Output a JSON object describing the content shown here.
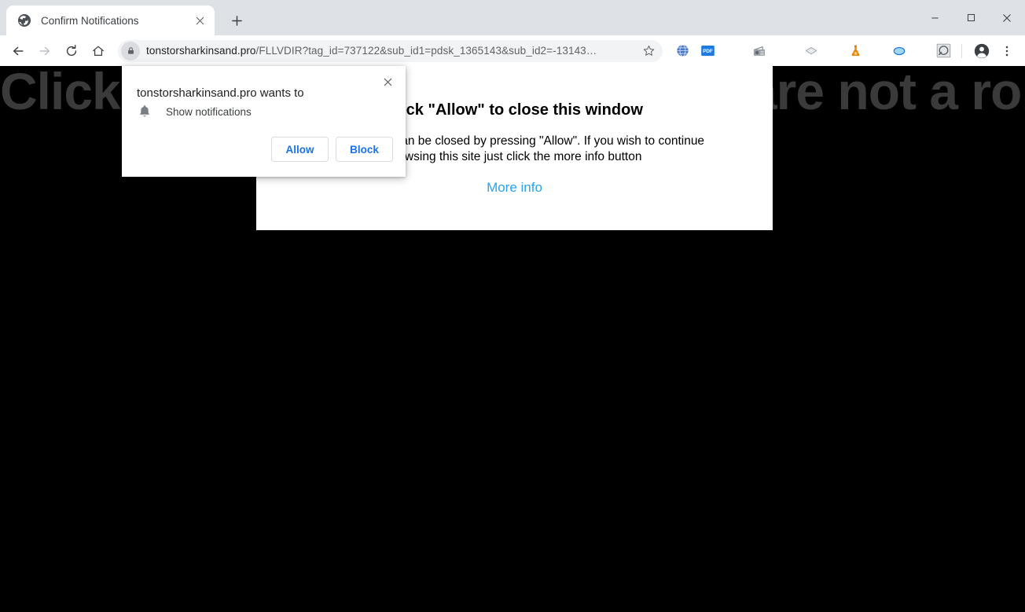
{
  "window": {
    "minimize_label": "Minimize",
    "maximize_label": "Maximize",
    "close_label": "Close"
  },
  "tabstrip": {
    "tab": {
      "title": "Confirm Notifications",
      "favicon": "globe-icon",
      "close_label": "×"
    },
    "new_tab_label": "+"
  },
  "toolbar": {
    "back_label": "←",
    "forward_label": "→",
    "reload_label": "⟳",
    "home_label": "⌂",
    "lock_icon": "lock-icon",
    "url_host": "tonstorsharkinsand.pro",
    "url_path": "/FLLVDIR?tag_id=737122&sub_id1=pdsk_1365143&sub_id2=-13143…",
    "bookmark_label": "☆",
    "extensions": [
      {
        "name": "globe-extension-icon",
        "glyph": ""
      },
      {
        "name": "pdf-extension-icon",
        "glyph": "PDF"
      },
      {
        "name": "radio-extension-icon",
        "glyph": ""
      },
      {
        "name": "diamond-extension-icon",
        "glyph": ""
      },
      {
        "name": "flask-extension-icon",
        "glyph": ""
      },
      {
        "name": "oval-extension-icon",
        "glyph": ""
      },
      {
        "name": "magnifier-extension-icon",
        "glyph": ""
      }
    ],
    "profile_label": "Profile",
    "menu_label": "⋮"
  },
  "page": {
    "headline": "Click Allow to confirm that you are not a robot",
    "card": {
      "heading": "Click \"Allow\" to close this window",
      "paragraph_line1": "This window can be closed by pressing \"Allow\". If you wish to continue",
      "paragraph_line2": "browsing this site just click the more info button",
      "link": "More info"
    },
    "background_color": "#000000"
  },
  "permission_bubble": {
    "title": "tonstorsharkinsand.pro wants to",
    "close_label": "×",
    "permission_icon": "bell-icon",
    "permission_label": "Show notifications",
    "allow_label": "Allow",
    "block_label": "Block",
    "accent_color": "#1a73e8"
  }
}
